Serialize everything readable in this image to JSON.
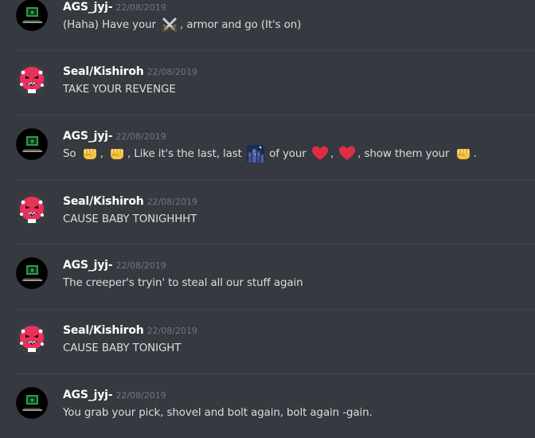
{
  "messages": [
    {
      "author": "AGS_jyj-",
      "timestamp": "22/08/2019",
      "avatar": "ags-monitor-avatar",
      "segments": [
        {
          "t": "text",
          "v": "(Haha) Have your "
        },
        {
          "t": "emoji",
          "name": "crossed-swords-emoji"
        },
        {
          "t": "text",
          "v": ", armor and go (It's on)"
        }
      ]
    },
    {
      "author": "Seal/Kishiroh",
      "timestamp": "22/08/2019",
      "avatar": "seal-pink-avatar",
      "segments": [
        {
          "t": "text",
          "v": "TAKE YOUR REVENGE"
        }
      ]
    },
    {
      "author": "AGS_jyj-",
      "timestamp": "22/08/2019",
      "avatar": "ags-monitor-avatar",
      "segments": [
        {
          "t": "text",
          "v": "So "
        },
        {
          "t": "emoji",
          "name": "fist-emoji"
        },
        {
          "t": "text",
          "v": ", "
        },
        {
          "t": "emoji",
          "name": "fist-emoji"
        },
        {
          "t": "text",
          "v": ", Like it's the last, last "
        },
        {
          "t": "emoji",
          "name": "night-city-emoji"
        },
        {
          "t": "text",
          "v": " of your "
        },
        {
          "t": "emoji",
          "name": "heart-emoji"
        },
        {
          "t": "text",
          "v": ", "
        },
        {
          "t": "emoji",
          "name": "heart-emoji"
        },
        {
          "t": "text",
          "v": ", show them your "
        },
        {
          "t": "emoji",
          "name": "fist-emoji"
        },
        {
          "t": "text",
          "v": "."
        }
      ]
    },
    {
      "author": "Seal/Kishiroh",
      "timestamp": "22/08/2019",
      "avatar": "seal-pink-avatar",
      "segments": [
        {
          "t": "text",
          "v": "CAUSE BABY TONIGHHHT"
        }
      ]
    },
    {
      "author": "AGS_jyj-",
      "timestamp": "22/08/2019",
      "avatar": "ags-monitor-avatar",
      "segments": [
        {
          "t": "text",
          "v": "The creeper's tryin' to steal all our stuff again"
        }
      ]
    },
    {
      "author": "Seal/Kishiroh",
      "timestamp": "22/08/2019",
      "avatar": "seal-pink-avatar",
      "segments": [
        {
          "t": "text",
          "v": "CAUSE BABY TONIGHT"
        }
      ]
    },
    {
      "author": "AGS_jyj-",
      "timestamp": "22/08/2019",
      "avatar": "ags-monitor-avatar",
      "segments": [
        {
          "t": "text",
          "v": "You grab your pick, shovel and bolt again, bolt again -gain."
        }
      ]
    }
  ],
  "colors": {
    "background": "#36393f",
    "divider": "#41444a",
    "username": "#ffffff",
    "timestamp": "#72767d",
    "message_text": "#dcddde",
    "seal_avatar": "#e8325a",
    "ags_avatar": "#000000"
  }
}
